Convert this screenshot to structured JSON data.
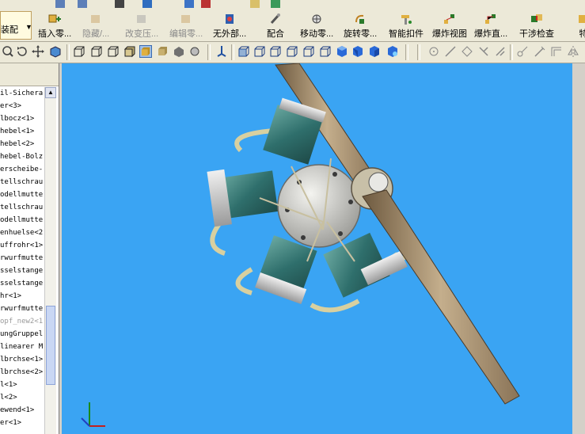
{
  "window": {
    "menu_strip_icons": [
      "undo-icon",
      "redo-icon",
      "select-icon",
      "rebuild-icon",
      "window-icon",
      "options-icon",
      "help-icon",
      "pin-icon"
    ]
  },
  "ribbon": {
    "first_button_label": "装配",
    "buttons": [
      {
        "label": "插入零...",
        "icon": "insert-component-icon",
        "enabled": true
      },
      {
        "label": "隐藏/...",
        "icon": "hide-show-icon",
        "enabled": false
      },
      {
        "label": "改变压...",
        "icon": "change-suppression-icon",
        "enabled": false
      },
      {
        "label": "编辑零...",
        "icon": "edit-component-icon",
        "enabled": false
      },
      {
        "label": "无外部...",
        "icon": "no-external-references-icon",
        "enabled": true
      },
      {
        "label": "配合",
        "icon": "mate-icon",
        "enabled": true
      },
      {
        "label": "移动零...",
        "icon": "move-component-icon",
        "enabled": true
      },
      {
        "label": "旋转零...",
        "icon": "rotate-component-icon",
        "enabled": true
      },
      {
        "label": "智能扣件",
        "icon": "smart-fasteners-icon",
        "enabled": true
      },
      {
        "label": "爆炸视图",
        "icon": "exploded-view-icon",
        "enabled": true
      },
      {
        "label": "爆炸直...",
        "icon": "explode-line-sketch-icon",
        "enabled": true
      },
      {
        "label": "干涉检查",
        "icon": "interference-detection-icon",
        "enabled": true
      },
      {
        "label": "特",
        "icon": "features-icon",
        "enabled": true
      }
    ]
  },
  "view_toolbar": {
    "icons": [
      "zoom-to-fit-icon",
      "rotate-view-icon",
      "pan-icon",
      "section-view-icon",
      "wireframe-icon",
      "hidden-lines-visible-icon",
      "hidden-lines-removed-icon",
      "shaded-with-edges-icon",
      "shaded-icon",
      "shadows-icon",
      "perspective-icon",
      "view-orientation-icon",
      "front-view-icon",
      "back-view-icon",
      "left-view-icon",
      "right-view-icon",
      "top-view-icon",
      "bottom-view-icon",
      "isometric-view-icon",
      "trimetric-view-icon",
      "dimetric-view-icon",
      "sketch-point-icon",
      "sketch-line-icon",
      "sketch-rectangle-icon",
      "sketch-circle-icon",
      "sketch-arc-icon",
      "trim-icon",
      "extend-icon",
      "offset-icon",
      "mirror-icon"
    ]
  },
  "feature_tree": {
    "items": [
      {
        "text": "il-Sichera",
        "gray": false
      },
      {
        "text": "er<3>",
        "gray": false
      },
      {
        "text": "lbocz<1>",
        "gray": false
      },
      {
        "text": "hebel<1>",
        "gray": false
      },
      {
        "text": "hebel<2>",
        "gray": false
      },
      {
        "text": "hebel-Bolz",
        "gray": false
      },
      {
        "text": "erscheibe-",
        "gray": false
      },
      {
        "text": "tellschrau",
        "gray": false
      },
      {
        "text": "odellmutte",
        "gray": false
      },
      {
        "text": "tellschrau",
        "gray": false
      },
      {
        "text": "odellmutte",
        "gray": false
      },
      {
        "text": "enhuelse<2",
        "gray": false
      },
      {
        "text": "uffrohr<1>",
        "gray": false
      },
      {
        "text": "rwurfmutte",
        "gray": false
      },
      {
        "text": "sselstange",
        "gray": false
      },
      {
        "text": "sselstange",
        "gray": false
      },
      {
        "text": "hr<1>",
        "gray": false
      },
      {
        "text": "rwurfmutte",
        "gray": false
      },
      {
        "text": "opf_new2<1",
        "gray": true
      },
      {
        "text": "ungGruppel",
        "gray": false
      },
      {
        "text": "linearer M",
        "gray": false
      },
      {
        "text": "lbrchse<1>",
        "gray": false
      },
      {
        "text": "lbrchse<2>",
        "gray": false
      },
      {
        "text": "l<1>",
        "gray": false
      },
      {
        "text": "l<2>",
        "gray": false
      },
      {
        "text": "ewend<1>",
        "gray": false
      },
      {
        "text": "er<1>",
        "gray": false
      }
    ]
  },
  "viewport": {
    "background": "#3aa4f3",
    "model": "radial-engine-with-propeller",
    "triad": [
      "x-axis",
      "y-axis",
      "z-axis"
    ]
  }
}
